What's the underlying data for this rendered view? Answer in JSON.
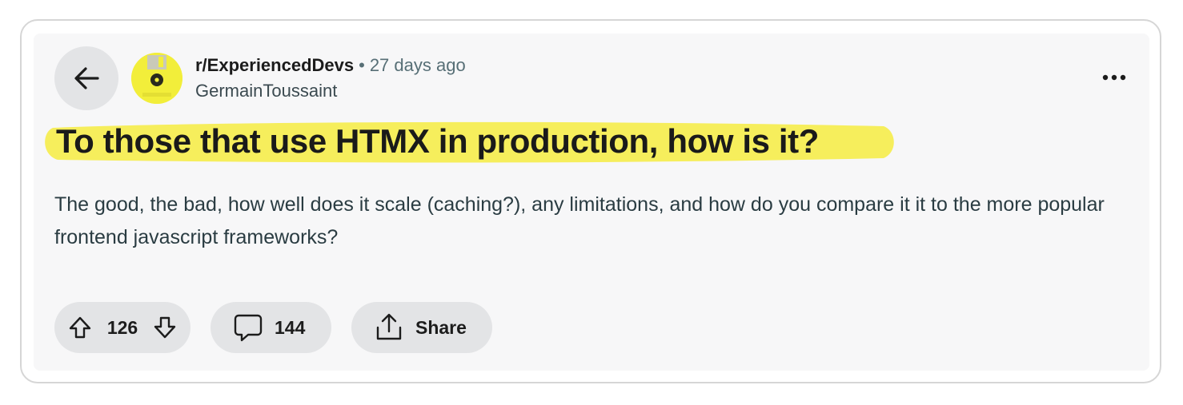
{
  "post": {
    "subreddit": "r/ExperiencedDevs",
    "separator": "•",
    "time_ago": "27 days ago",
    "author": "GermainToussaint",
    "title": "To those that use HTMX in production, how is it?",
    "body": "The good, the bad, how well does it scale (caching?), any limitations, and how do you compare it it to the more popular frontend javascript frameworks?",
    "highlight_color": "#f6ee5c"
  },
  "actions": {
    "upvote_count": "126",
    "comment_count": "144",
    "share_label": "Share"
  },
  "icons": {
    "back": "arrow-left-icon",
    "more": "ellipsis-icon",
    "upvote": "arrow-up-icon",
    "downvote": "arrow-down-icon",
    "comment": "speech-bubble-icon",
    "share": "share-upload-icon",
    "avatar": "subreddit-avatar-floppy-disk"
  }
}
